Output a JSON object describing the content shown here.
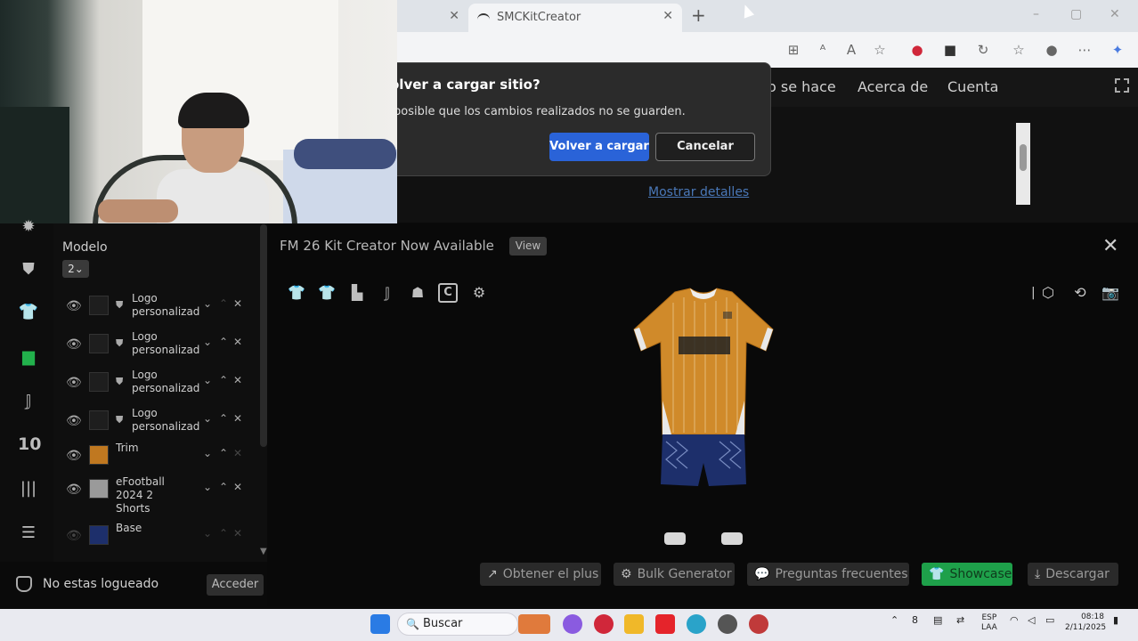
{
  "browser": {
    "tab_active_title": "SMCKitCreator",
    "tab_close": "✕",
    "new_tab": "+"
  },
  "dialog": {
    "title": "olver a cargar sitio?",
    "message": "posible que los cambios realizados no se guarden.",
    "reload_label": "Volver a cargar",
    "cancel_label": "Cancelar"
  },
  "site": {
    "nav": [
      "o se hace",
      "Acerca de",
      "Cuenta"
    ],
    "show_details": "Mostrar detalles"
  },
  "app": {
    "title": "FM 26 Kit Creator Now Available",
    "view_badge": "View",
    "modelo_label": "Modelo",
    "modelo_value": "2",
    "layers": [
      {
        "name": "Logo personalizad",
        "color": "#1e1e1e",
        "shield": true
      },
      {
        "name": "Logo personalizad",
        "color": "#1e1e1e",
        "shield": true
      },
      {
        "name": "Logo personalizad",
        "color": "#1e1e1e",
        "shield": true
      },
      {
        "name": "Logo personalizad",
        "color": "#1e1e1e",
        "shield": true
      },
      {
        "name": "Trim",
        "color": "#c07820",
        "shield": false
      },
      {
        "name": "eFootball 2024 2 Shorts",
        "color": "#9a9a9a",
        "shield": false
      },
      {
        "name": "Base",
        "color": "#1d2f6b",
        "shield": false
      }
    ],
    "rail_number": "10",
    "login_text": "No estas logueado",
    "login_button": "Acceder",
    "bottom_buttons": [
      {
        "label": "Obtener el plus",
        "icon": "external-link-icon"
      },
      {
        "label": "Bulk Generator",
        "icon": "gear-icon"
      },
      {
        "label": "Preguntas frecuentes",
        "icon": "chat-icon"
      },
      {
        "label": "Showcase",
        "icon": "shirt-icon"
      },
      {
        "label": "Descargar",
        "icon": "download-icon"
      }
    ],
    "colors": {
      "accent_green": "#22b14c",
      "jersey_orange": "#d08a2a",
      "shorts_navy": "#1d2f6b"
    }
  },
  "taskbar": {
    "search_label": "Buscar",
    "lang_top": "ESP",
    "lang_bottom": "LAA",
    "time": "08:18",
    "date": "2/11/2025"
  }
}
